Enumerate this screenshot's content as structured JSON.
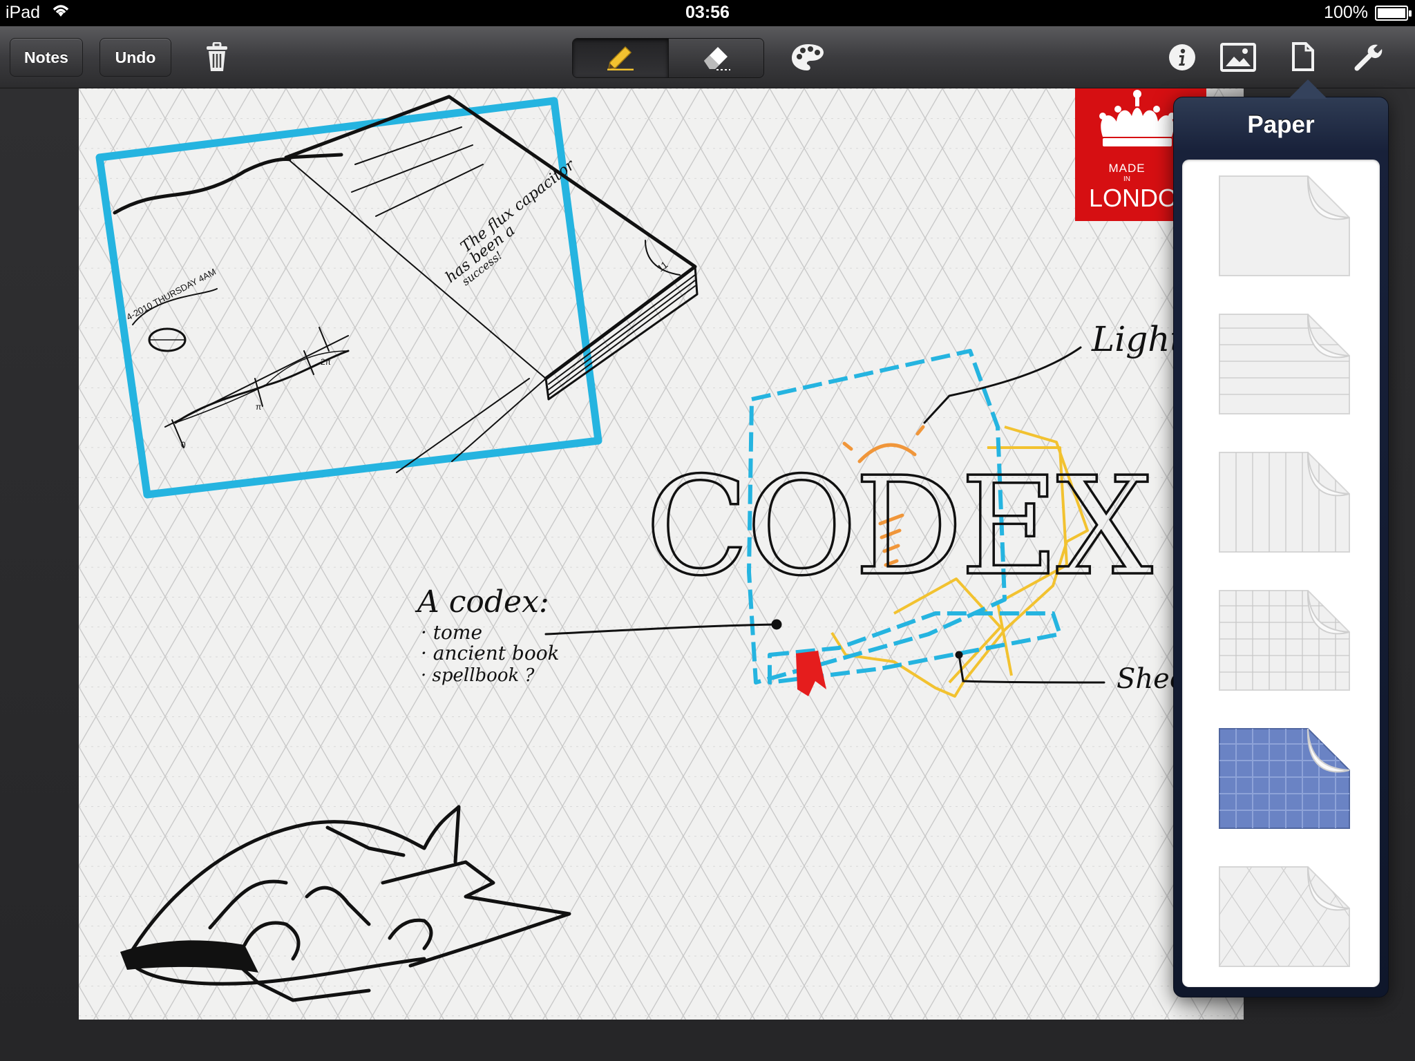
{
  "status_bar": {
    "device": "iPad",
    "wifi_icon": "wifi-icon",
    "time": "03:56",
    "battery": "100%",
    "battery_level": 1.0
  },
  "toolbar": {
    "notes_label": "Notes",
    "undo_label": "Undo",
    "trash_icon": "trash-icon",
    "pen_tool_icon": "pen-icon",
    "eraser_tool_icon": "eraser-icon",
    "active_tool": "pen",
    "palette_icon": "palette-icon",
    "info_icon": "info-icon",
    "image_icon": "image-icon",
    "paper_icon": "paper-icon",
    "settings_icon": "wrench-icon"
  },
  "canvas": {
    "paper_style": "isometric-grid",
    "notebook_text_1": "The flux capacitor",
    "notebook_text_2": "has been a",
    "notebook_text_3": "success!",
    "notebook_date": "4-2010 THURSDAY 4AM",
    "notebook_page_number": "11",
    "graph_label_zero": "0",
    "graph_label_pi": "π",
    "graph_label_2pi": "2π",
    "codex_word": "CODEX",
    "codex_heading": "A codex:",
    "codex_items": [
      "· tome",
      "· ancient book",
      "· spellbook ?"
    ],
    "label_lightbox": "Lightb",
    "label_sheet": "Sheet"
  },
  "badge": {
    "line1": "MADE",
    "line2": "IN",
    "line3": "LONDON",
    "color": "#d60f12"
  },
  "paper_popover": {
    "title": "Paper",
    "options": [
      {
        "name": "plain"
      },
      {
        "name": "lined"
      },
      {
        "name": "columns"
      },
      {
        "name": "grid"
      },
      {
        "name": "blueprint",
        "selected": true
      },
      {
        "name": "isometric"
      }
    ]
  },
  "colors": {
    "accent_blue": "#25b4e0",
    "accent_yellow": "#f2c230",
    "accent_orange": "#f0963a",
    "accent_red": "#e51d1d",
    "blueprint": "#6a83c4"
  }
}
